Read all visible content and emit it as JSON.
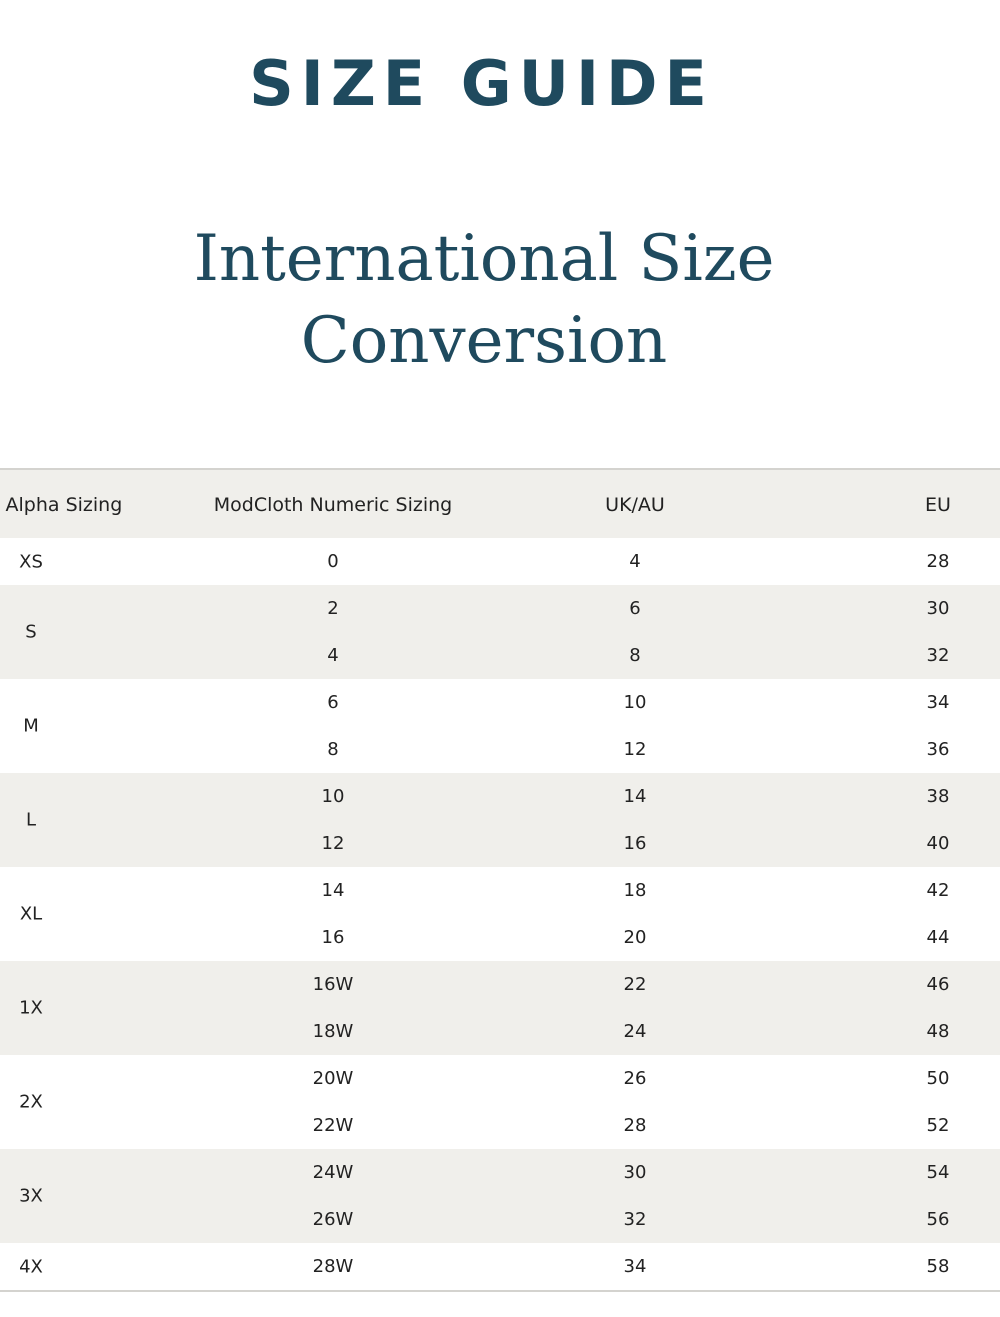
{
  "page": {
    "title": "SIZE GUIDE",
    "section_title_line1": "International Size",
    "section_title_line2": "Conversion"
  },
  "colors": {
    "heading": "#1f4a5e",
    "shaded_row": "#f0efeb",
    "border": "#d4d3cf"
  },
  "table": {
    "headers": {
      "alpha": "th Alpha Sizing",
      "numeric": "ModCloth Numeric Sizing",
      "uk_au": "UK/AU",
      "eu": "EU"
    },
    "groups": [
      {
        "alpha": "XS",
        "rows": [
          {
            "numeric": "0",
            "uk_au": "4",
            "eu": "28"
          }
        ]
      },
      {
        "alpha": "S",
        "rows": [
          {
            "numeric": "2",
            "uk_au": "6",
            "eu": "30"
          },
          {
            "numeric": "4",
            "uk_au": "8",
            "eu": "32"
          }
        ]
      },
      {
        "alpha": "M",
        "rows": [
          {
            "numeric": "6",
            "uk_au": "10",
            "eu": "34"
          },
          {
            "numeric": "8",
            "uk_au": "12",
            "eu": "36"
          }
        ]
      },
      {
        "alpha": "L",
        "rows": [
          {
            "numeric": "10",
            "uk_au": "14",
            "eu": "38"
          },
          {
            "numeric": "12",
            "uk_au": "16",
            "eu": "40"
          }
        ]
      },
      {
        "alpha": "XL",
        "rows": [
          {
            "numeric": "14",
            "uk_au": "18",
            "eu": "42"
          },
          {
            "numeric": "16",
            "uk_au": "20",
            "eu": "44"
          }
        ]
      },
      {
        "alpha": "1X",
        "rows": [
          {
            "numeric": "16W",
            "uk_au": "22",
            "eu": "46"
          },
          {
            "numeric": "18W",
            "uk_au": "24",
            "eu": "48"
          }
        ]
      },
      {
        "alpha": "2X",
        "rows": [
          {
            "numeric": "20W",
            "uk_au": "26",
            "eu": "50"
          },
          {
            "numeric": "22W",
            "uk_au": "28",
            "eu": "52"
          }
        ]
      },
      {
        "alpha": "3X",
        "rows": [
          {
            "numeric": "24W",
            "uk_au": "30",
            "eu": "54"
          },
          {
            "numeric": "26W",
            "uk_au": "32",
            "eu": "56"
          }
        ]
      },
      {
        "alpha": "4X",
        "rows": [
          {
            "numeric": "28W",
            "uk_au": "34",
            "eu": "58"
          }
        ]
      }
    ]
  }
}
